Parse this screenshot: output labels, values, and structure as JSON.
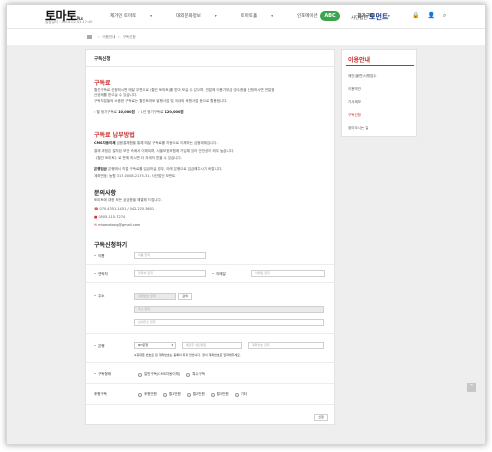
{
  "header": {
    "logo_text": "토마토",
    "logo_small": "Plus",
    "logo_sub": "설립일자 : 2018.02.03.17:40",
    "nav": [
      "제가인 토마토",
      "대외문화정보",
      "토마토홀",
      "인포메이션",
      "참가구독"
    ],
    "abc_badge": "ABC",
    "org_prefix": "사단법인",
    "org_name": "모먼트",
    "icons": [
      "lock-icon",
      "user-icon",
      "search-icon"
    ]
  },
  "breadcrumb": [
    "이용안내",
    "구독신청"
  ],
  "page": {
    "title": "구독신청",
    "sections": {
      "about_title": "구독료",
      "about_lines": [
        "월간구독료 신청하시면 매달 우편으로 (월간 토마토)를 받아 보실 수 있으며, 연말에 이용기부금 영수증을 신청하시면 연말정",
        "산공제를 받으실 수 있습니다.",
        "구독자분들의 소중한 구독료는 월간토마토 발행사업 및 국내외 후원사업 등으로 활용됩니다."
      ],
      "fee_monthly_label": "월 정기구독료",
      "fee_monthly_value": "10,000원",
      "fee_yearly_label": "1년 정기구독료",
      "fee_yearly_value": "120,000원",
      "payment_title": "구독료 납부방법",
      "payment_cms_head": "CMS자동이체",
      "payment_cms_text": " 금융결제원을 통해 매달 구독료를 자동으로 이체하는 금융제제입니다.",
      "payment_cms_lines": [
        "결제 과정은 절차된 보안 속에서 이체되며, 서울보호보험에 가입해 있어 안전성이 매우 높습니다.",
        "《월간 토마토》로 판매 하시면 더 자세히 받을 수 있습니다."
      ],
      "payment_bank_head": "은행입금",
      "payment_bank_text": " 은행에서 직접 구독료를 입금하실 경우, 아래 은행으로 입금해주시기 바랍니다.",
      "payment_account": "계좌번호: 농협 317-0008-2175-31, 사단법인 모먼트",
      "contact_title": "문의사항",
      "contact_intro": "토마토에 대한 모든 궁금증을 해결해 드립니다.",
      "contact_phone": "070.4351.1451 / 042.225.3601",
      "contact_fax": "0505.115.7274",
      "contact_email": "mtomatong@gmail.com"
    },
    "form": {
      "title": "구독신청하기",
      "name_label": "이름",
      "name_placeholder": "이름 입력",
      "phone_label": "연락처",
      "phone_placeholder": "연락처 입력",
      "email_label": "이메일",
      "email_placeholder": "이메일 입력",
      "address_label": "주소",
      "zip_placeholder": "우편번호 입력",
      "zip_button": "검색",
      "addr1_placeholder": "주소 입력",
      "addr2_placeholder": "상세주소 입력",
      "bank_label": "은행",
      "bank_select": "NH은행",
      "holder_placeholder": "예금주 생년월일",
      "account_placeholder": "계좌번호 입력",
      "bank_note": "※휴대폰 번호로 된 계좌번호는 등록이 되지 않습니다. 정식 계좌번호로 입력해주세요.",
      "type_label": "구독형태",
      "type_options": [
        "일반구독(CMS자동이체)",
        "특수구독"
      ],
      "period_label": "후원구독",
      "period_options": [
        "후원만원",
        "월1만원",
        "월2만원",
        "월3만원",
        "기타"
      ],
      "submit_label": "신청"
    }
  },
  "sidebar": {
    "title": "이용안내",
    "items": [
      "제안(불편)사항접수",
      "이용약관",
      "기사제보",
      "구독신청",
      "찾아오시는 길"
    ],
    "active_index": 3
  },
  "top_button": "^"
}
